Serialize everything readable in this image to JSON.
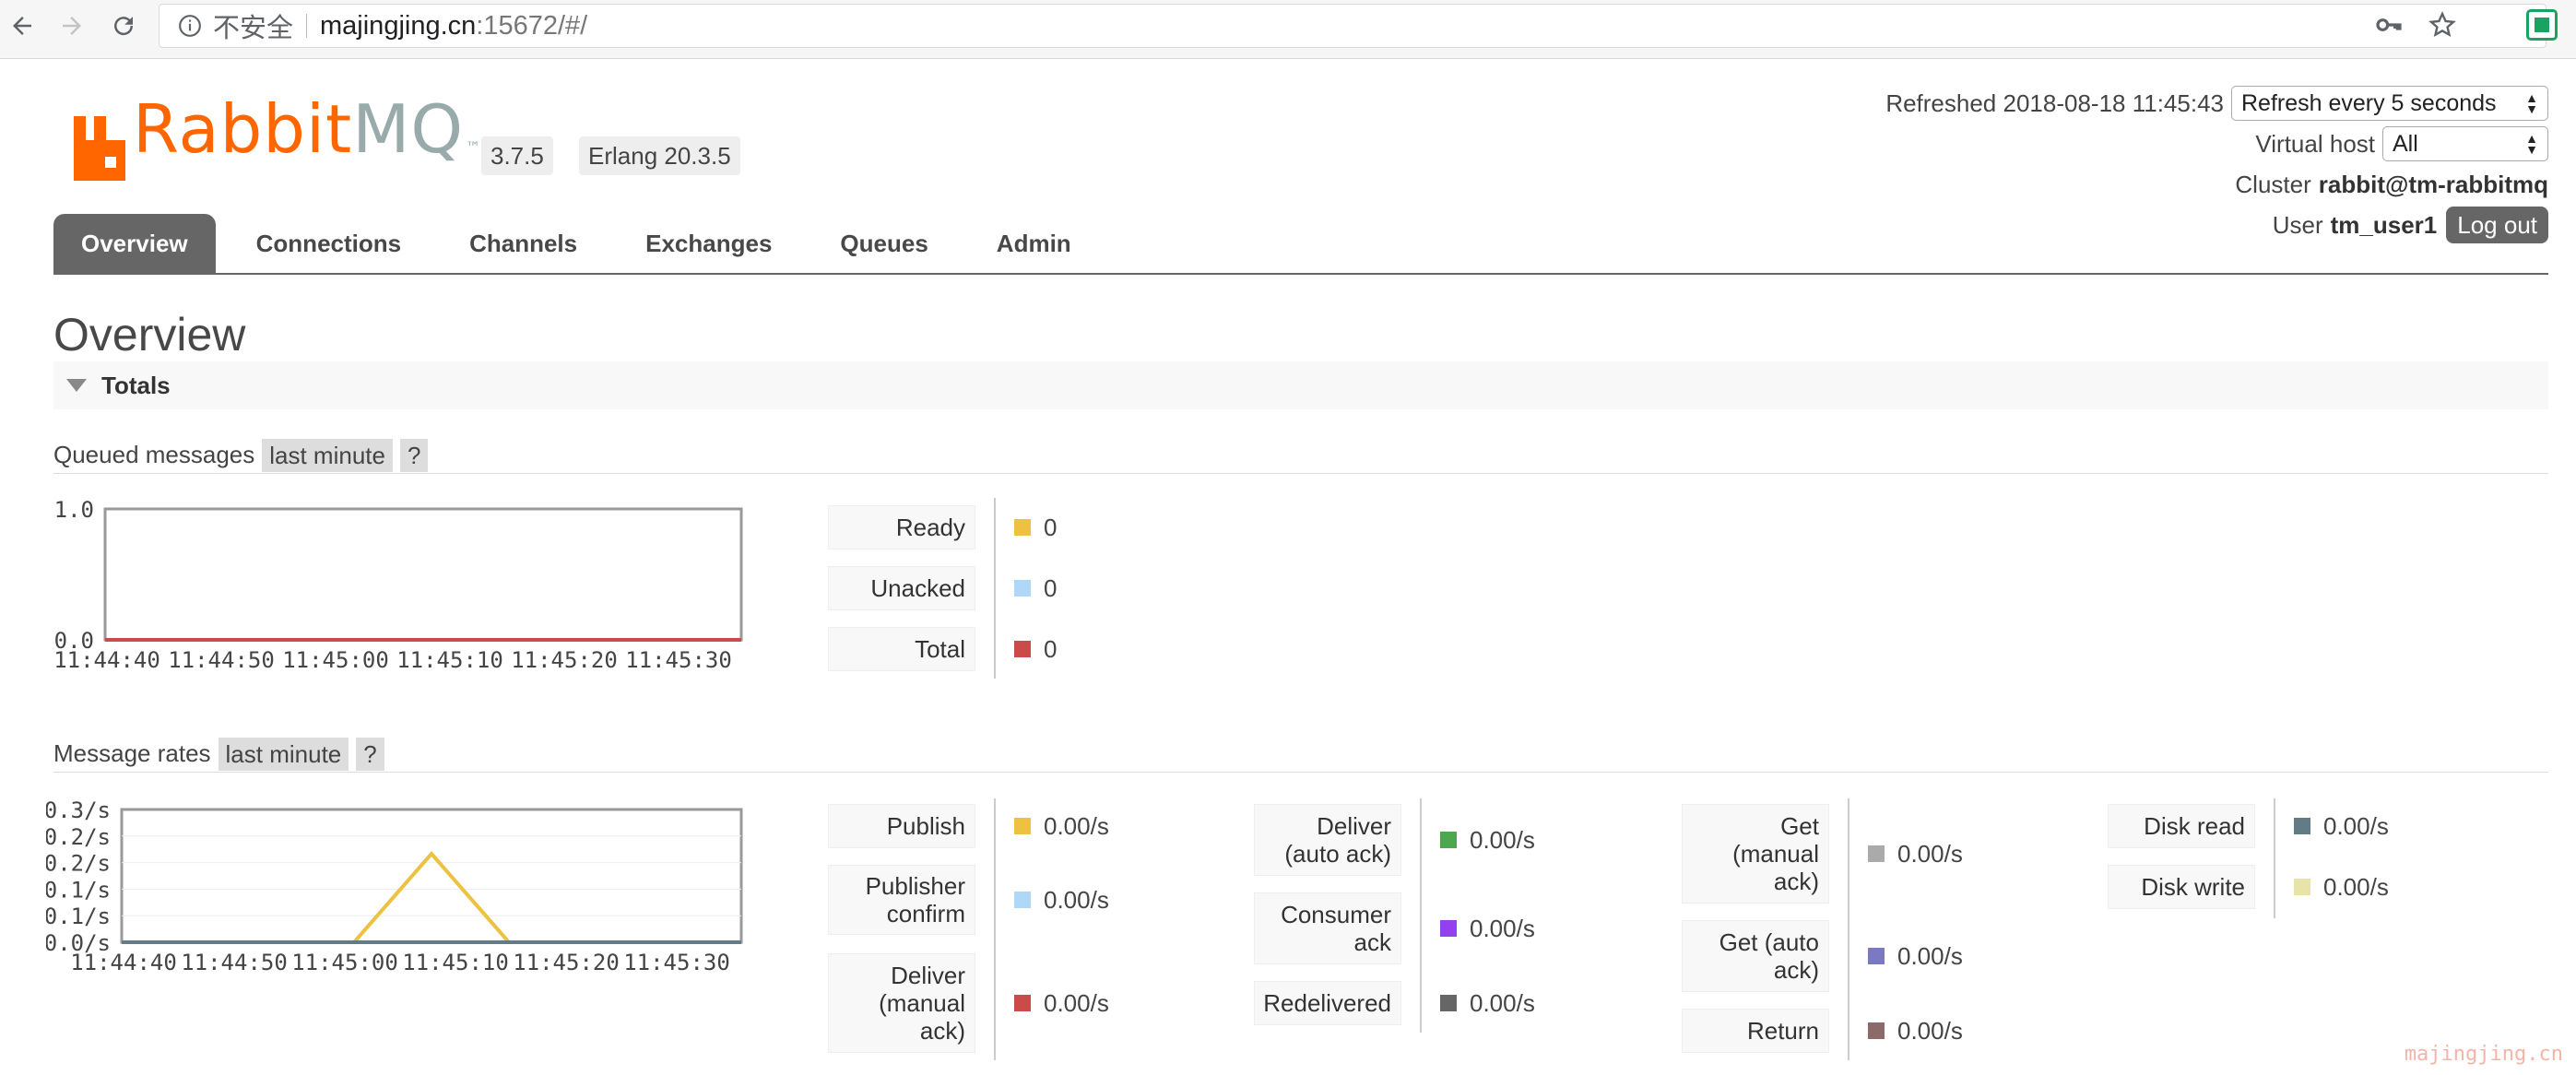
{
  "browser": {
    "insecure_label": "不安全",
    "url_host": "majingjing.cn",
    "url_path": ":15672/#/"
  },
  "header": {
    "logo_rabbit": "Rabbit",
    "logo_mq": "MQ",
    "logo_tm": "™",
    "version": "3.7.5",
    "erlang": "Erlang 20.3.5",
    "refreshed_label": "Refreshed 2018-08-18 11:45:43",
    "refresh_select": "Refresh every 5 seconds",
    "vhost_label": "Virtual host",
    "vhost_select": "All",
    "cluster_label": "Cluster",
    "cluster_name": "rabbit@tm-rabbitmq",
    "user_label": "User",
    "user_name": "tm_user1",
    "logout": "Log out"
  },
  "tabs": [
    "Overview",
    "Connections",
    "Channels",
    "Exchanges",
    "Queues",
    "Admin"
  ],
  "page_title": "Overview",
  "section_title": "Totals",
  "queued": {
    "title": "Queued messages",
    "range": "last minute",
    "help": "?",
    "rows": [
      {
        "label": "Ready",
        "value": "0",
        "color": "#edc240"
      },
      {
        "label": "Unacked",
        "value": "0",
        "color": "#afd8f8"
      },
      {
        "label": "Total",
        "value": "0",
        "color": "#cb4b4b"
      }
    ]
  },
  "rates": {
    "title": "Message rates",
    "range": "last minute",
    "help": "?",
    "col1": [
      {
        "label": "Publish",
        "value": "0.00/s",
        "color": "#edc240"
      },
      {
        "label": "Publisher confirm",
        "value": "0.00/s",
        "color": "#afd8f8"
      },
      {
        "label": "Deliver (manual ack)",
        "value": "0.00/s",
        "color": "#cb4b4b"
      }
    ],
    "col2": [
      {
        "label": "Deliver (auto ack)",
        "value": "0.00/s",
        "color": "#4da74d"
      },
      {
        "label": "Consumer ack",
        "value": "0.00/s",
        "color": "#9440ed"
      },
      {
        "label": "Redelivered",
        "value": "0.00/s",
        "color": "#666666"
      }
    ],
    "col3": [
      {
        "label": "Get (manual ack)",
        "value": "0.00/s",
        "color": "#aaaaaa"
      },
      {
        "label": "Get (auto ack)",
        "value": "0.00/s",
        "color": "#7c79c3"
      },
      {
        "label": "Return",
        "value": "0.00/s",
        "color": "#8d6a6a"
      }
    ],
    "col4": [
      {
        "label": "Disk read",
        "value": "0.00/s",
        "color": "#637b85"
      },
      {
        "label": "Disk write",
        "value": "0.00/s",
        "color": "#e8e4a8"
      }
    ]
  },
  "chart_data": [
    {
      "type": "line",
      "ylim": [
        0,
        1.0
      ],
      "yticks": [
        "1.0",
        "0.0"
      ],
      "x": [
        "11:44:40",
        "11:44:50",
        "11:45:00",
        "11:45:10",
        "11:45:20",
        "11:45:30"
      ],
      "series": [
        {
          "name": "Total",
          "color": "#cb4b4b",
          "values": [
            0,
            0,
            0,
            0,
            0,
            0,
            0
          ]
        }
      ]
    },
    {
      "type": "line",
      "ylim": [
        0,
        0.3
      ],
      "yticks": [
        "0.3/s",
        "0.2/s",
        "0.2/s",
        "0.1/s",
        "0.1/s",
        "0.0/s"
      ],
      "x": [
        "11:44:40",
        "11:44:50",
        "11:45:00",
        "11:45:10",
        "11:45:20",
        "11:45:30"
      ],
      "series": [
        {
          "name": "Publish",
          "color": "#edc240",
          "values": [
            0,
            0,
            0,
            0,
            0.2,
            0,
            0,
            0,
            0
          ]
        },
        {
          "name": "Disk read",
          "color": "#637b85",
          "values": [
            0,
            0,
            0,
            0,
            0,
            0,
            0,
            0,
            0
          ]
        }
      ]
    }
  ],
  "watermark": "majingjing.cn"
}
